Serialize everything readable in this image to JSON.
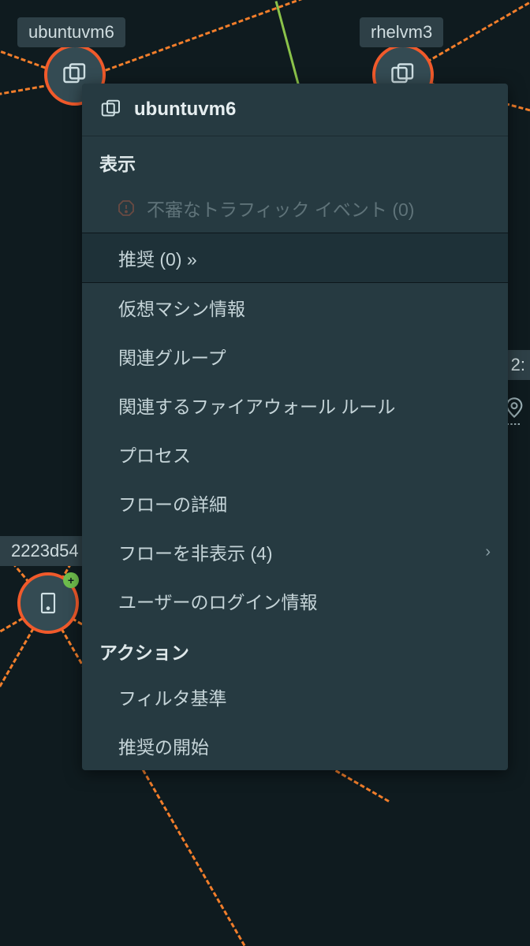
{
  "nodes": {
    "ubuntuvm6": {
      "label": "ubuntuvm6"
    },
    "rhelvm3": {
      "label": "rhelvm3"
    },
    "d22": {
      "label": "2223d54"
    },
    "right_truncated": {
      "label": "2:"
    }
  },
  "context_menu": {
    "title": "ubuntuvm6",
    "section_view": "表示",
    "items": {
      "suspicious": "不審なトラフィック イベント (0)",
      "recommend": "推奨 (0) »",
      "vm_info": "仮想マシン情報",
      "related_groups": "関連グループ",
      "related_fw_rules": "関連するファイアウォール ルール",
      "processes": "プロセス",
      "flow_details": "フローの詳細",
      "hide_flows": "フローを非表示 (4)",
      "user_login": "ユーザーのログイン情報"
    },
    "section_action": "アクション",
    "action_items": {
      "filter_criteria": "フィルタ基準",
      "start_recommend": "推奨の開始"
    }
  }
}
